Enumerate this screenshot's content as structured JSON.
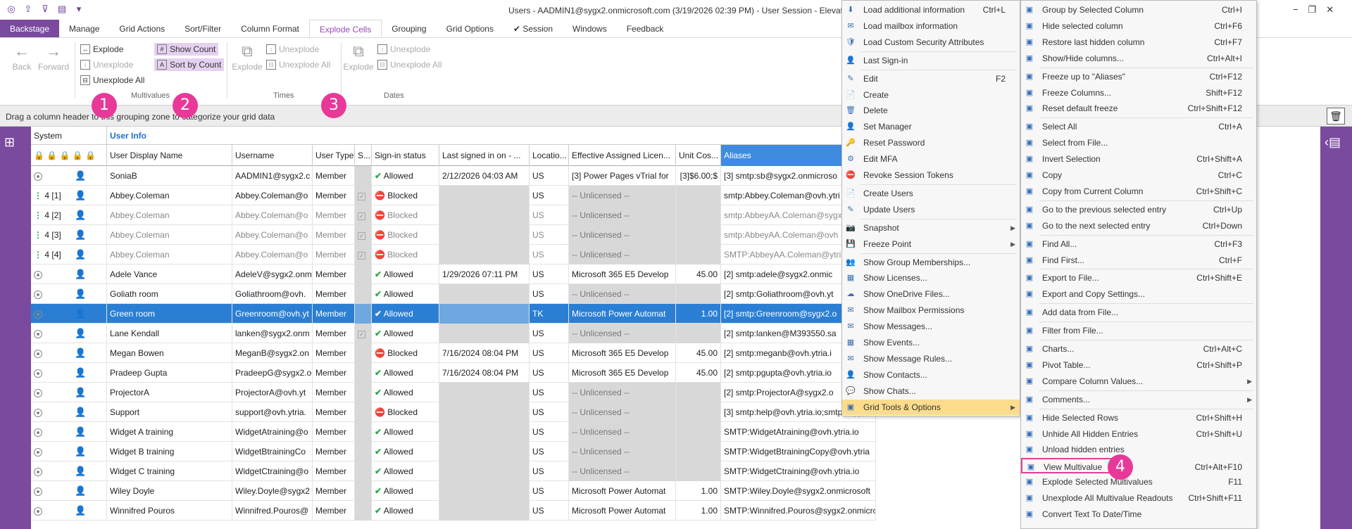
{
  "window": {
    "title": "Users - AADMIN1@sygx2.onmicrosoft.com (3/19/2026 02:39 PM) - User Session - Elevated",
    "controls": [
      "−",
      "❐",
      "✕"
    ]
  },
  "ribbon": {
    "tabs": [
      "Backstage",
      "Manage",
      "Grid Actions",
      "Sort/Filter",
      "Column Format",
      "Explode Cells",
      "Grouping",
      "Grid Options",
      "✔ Session",
      "Windows",
      "Feedback"
    ],
    "back_label": "Back",
    "forward_label": "Forward",
    "explode": "Explode",
    "unexplode": "Unexplode",
    "unexplode_all": "Unexplode All",
    "show_count": "Show Count",
    "sort_by_count": "Sort by Count",
    "multivalues_group": "Multivalues",
    "times_explode": "Explode",
    "times_unexplode": "Unexplode",
    "times_unexplode_all": "Unexplode All",
    "times_group": "Times",
    "dates_explode": "Explode",
    "dates_unexplode": "Unexplode",
    "dates_unexplode_all": "Unexplode All",
    "dates_group": "Dates"
  },
  "group_zone": {
    "text": "Drag a column header to this grouping zone to categorize your grid data"
  },
  "grid": {
    "bands": {
      "system": "System",
      "user_info": "User Info"
    },
    "columns": [
      "User Display Name",
      "Username",
      "User Type",
      "S...",
      "Sign-in status",
      "Last signed in on - ...",
      "Locatio...",
      "Effective Assigned Licen...",
      "Unit Cos...",
      "Aliases"
    ],
    "rows": [
      {
        "n": "",
        "idx": "",
        "name": "SoniaB",
        "user": "AADMIN1@sygx2.c",
        "type": "Member",
        "s": "",
        "status": "Allowed",
        "last": "2/12/2026 04:03 AM",
        "loc": "US",
        "lic": "[3] Power Pages vTrial for",
        "cost": "[3]$6.00;$",
        "alias": "[3] smtp:sb@sygx2.onmicroso",
        "kind": "normal"
      },
      {
        "n": "4",
        "idx": "[1]",
        "name": "Abbey.Coleman",
        "user": "Abbey.Coleman@o",
        "type": "Member",
        "s": "chk",
        "status": "Blocked",
        "last": "",
        "loc": "US",
        "lic": "-- Unlicensed --",
        "cost": "",
        "alias": "smtp:Abbey.Coleman@ovh.ytri",
        "kind": "multi"
      },
      {
        "n": "4",
        "idx": "[2]",
        "name": "Abbey.Coleman",
        "user": "Abbey.Coleman@o",
        "type": "Member",
        "s": "chk",
        "status": "Blocked",
        "last": "",
        "loc": "US",
        "lic": "-- Unlicensed --",
        "cost": "",
        "alias": "smtp:AbbeyAA.Coleman@sygx",
        "kind": "dim"
      },
      {
        "n": "4",
        "idx": "[3]",
        "name": "Abbey.Coleman",
        "user": "Abbey.Coleman@o",
        "type": "Member",
        "s": "chk",
        "status": "Blocked",
        "last": "",
        "loc": "US",
        "lic": "-- Unlicensed --",
        "cost": "",
        "alias": "smtp:AbbeyAA.Coleman@ovh",
        "kind": "dim"
      },
      {
        "n": "4",
        "idx": "[4]",
        "name": "Abbey.Coleman",
        "user": "Abbey.Coleman@o",
        "type": "Member",
        "s": "chk",
        "status": "Blocked",
        "last": "",
        "loc": "US",
        "lic": "-- Unlicensed --",
        "cost": "",
        "alias": "SMTP:AbbeyAA.Coleman@ytri",
        "kind": "dim"
      },
      {
        "n": "",
        "idx": "",
        "name": "Adele Vance",
        "user": "AdeleV@sygx2.onm",
        "type": "Member",
        "s": "",
        "status": "Allowed",
        "last": "1/29/2026 07:11 PM",
        "loc": "US",
        "lic": "Microsoft 365 E5 Develop",
        "cost": "45.00",
        "alias": "[2] smtp:adele@sygx2.onmic",
        "kind": "normal"
      },
      {
        "n": "",
        "idx": "",
        "name": "Goliath room",
        "user": "Goliathroom@ovh.",
        "type": "Member",
        "s": "",
        "status": "Allowed",
        "last": "",
        "loc": "US",
        "lic": "-- Unlicensed --",
        "cost": "",
        "alias": "[2] smtp:Goliathroom@ovh.yt",
        "kind": "normal"
      },
      {
        "n": "",
        "idx": "",
        "name": "Green room",
        "user": "Greenroom@ovh.yt",
        "type": "Member",
        "s": "",
        "status": "Allowed",
        "last": "",
        "loc": "TK",
        "lic": "Microsoft Power Automat",
        "cost": "1.00",
        "alias": "[2] smtp:Greenroom@sygx2.o",
        "kind": "sel"
      },
      {
        "n": "",
        "idx": "",
        "name": "Lane Kendall",
        "user": "lanken@sygx2.onm",
        "type": "Member",
        "s": "chk",
        "status": "Allowed",
        "last": "",
        "loc": "US",
        "lic": "-- Unlicensed --",
        "cost": "",
        "alias": "[2] smtp:lanken@M393550.sa",
        "kind": "normal"
      },
      {
        "n": "",
        "idx": "",
        "name": "Megan Bowen",
        "user": "MeganB@sygx2.on",
        "type": "Member",
        "s": "",
        "status": "Blocked",
        "last": "7/16/2024 08:04 PM",
        "loc": "US",
        "lic": "Microsoft 365 E5 Develop",
        "cost": "45.00",
        "alias": "[2] smtp:meganb@ovh.ytria.i",
        "kind": "normal"
      },
      {
        "n": "",
        "idx": "",
        "name": "Pradeep Gupta",
        "user": "PradeepG@sygx2.o",
        "type": "Member",
        "s": "",
        "status": "Allowed",
        "last": "7/16/2024 08:04 PM",
        "loc": "US",
        "lic": "Microsoft 365 E5 Develop",
        "cost": "45.00",
        "alias": "[2] smtp:pgupta@ovh.ytria.io",
        "kind": "normal"
      },
      {
        "n": "",
        "idx": "",
        "name": "ProjectorA",
        "user": "ProjectorA@ovh.yt",
        "type": "Member",
        "s": "",
        "status": "Allowed",
        "last": "",
        "loc": "US",
        "lic": "-- Unlicensed --",
        "cost": "",
        "alias": "[2] smtp:ProjectorA@sygx2.o",
        "kind": "normal"
      },
      {
        "n": "",
        "idx": "",
        "name": "Support",
        "user": "support@ovh.ytria.",
        "type": "Member",
        "s": "",
        "status": "Blocked",
        "last": "",
        "loc": "US",
        "lic": "-- Unlicensed --",
        "cost": "",
        "alias": "[3] smtp:help@ovh.ytria.io;smtp:supp",
        "kind": "normal"
      },
      {
        "n": "",
        "idx": "",
        "name": "Widget A training",
        "user": "WidgetAtraining@o",
        "type": "Member",
        "s": "",
        "status": "Allowed",
        "last": "",
        "loc": "US",
        "lic": "-- Unlicensed --",
        "cost": "",
        "alias": "SMTP:WidgetAtraining@ovh.ytria.io",
        "kind": "normal"
      },
      {
        "n": "",
        "idx": "",
        "name": "Widget B training",
        "user": "WidgetBtrainingCo",
        "type": "Member",
        "s": "",
        "status": "Allowed",
        "last": "",
        "loc": "US",
        "lic": "-- Unlicensed --",
        "cost": "",
        "alias": "SMTP:WidgetBtrainingCopy@ovh.ytria",
        "kind": "normal"
      },
      {
        "n": "",
        "idx": "",
        "name": "Widget C training",
        "user": "WidgetCtraining@o",
        "type": "Member",
        "s": "",
        "status": "Allowed",
        "last": "",
        "loc": "US",
        "lic": "-- Unlicensed --",
        "cost": "",
        "alias": "SMTP:WidgetCtraining@ovh.ytria.io",
        "kind": "normal"
      },
      {
        "n": "",
        "idx": "",
        "name": "Wiley Doyle",
        "user": "Wiley.Doyle@sygx2",
        "type": "Member",
        "s": "",
        "status": "Allowed",
        "last": "",
        "loc": "US",
        "lic": "Microsoft Power Automat",
        "cost": "1.00",
        "alias": "SMTP:Wiley.Doyle@sygx2.onmicrosoft",
        "kind": "normal"
      },
      {
        "n": "",
        "idx": "",
        "name": "Winnifred Pouros",
        "user": "Winnifred.Pouros@",
        "type": "Member",
        "s": "",
        "status": "Allowed",
        "last": "",
        "loc": "US",
        "lic": "Microsoft Power Automat",
        "cost": "1.00",
        "alias": "SMTP:Winnifred.Pouros@sygx2.onmicro",
        "kind": "normal"
      }
    ]
  },
  "context_menu": {
    "items": [
      {
        "label": "Load additional information",
        "shortcut": "Ctrl+L",
        "icon": "⬇"
      },
      {
        "label": "Load mailbox information",
        "shortcut": "",
        "icon": "✉"
      },
      {
        "label": "Load Custom Security Attributes",
        "shortcut": "",
        "icon": "🛡"
      },
      {
        "sep": true
      },
      {
        "label": "Last Sign-in",
        "shortcut": "",
        "icon": "👤"
      },
      {
        "sep": true
      },
      {
        "label": "Edit",
        "shortcut": "F2",
        "icon": "✎"
      },
      {
        "label": "Create",
        "shortcut": "",
        "icon": "📄"
      },
      {
        "label": "Delete",
        "shortcut": "",
        "icon": "🗑"
      },
      {
        "label": "Set Manager",
        "shortcut": "",
        "icon": "👤"
      },
      {
        "label": "Reset Password",
        "shortcut": "",
        "icon": "🔑"
      },
      {
        "label": "Edit MFA",
        "shortcut": "",
        "icon": "⚙"
      },
      {
        "label": "Revoke Session Tokens",
        "shortcut": "",
        "icon": "⛔"
      },
      {
        "sep": true
      },
      {
        "label": "Create Users",
        "shortcut": "",
        "icon": "📄"
      },
      {
        "label": "Update Users",
        "shortcut": "",
        "icon": "✎"
      },
      {
        "sep": true
      },
      {
        "label": "Snapshot",
        "shortcut": "",
        "icon": "📷",
        "sub": true
      },
      {
        "label": "Freeze Point",
        "shortcut": "",
        "icon": "💾",
        "sub": true
      },
      {
        "sep": true
      },
      {
        "label": "Show Group Memberships...",
        "shortcut": "",
        "icon": "👥"
      },
      {
        "label": "Show Licenses...",
        "shortcut": "",
        "icon": "▦"
      },
      {
        "label": "Show OneDrive Files...",
        "shortcut": "",
        "icon": "☁"
      },
      {
        "label": "Show Mailbox Permissions",
        "shortcut": "",
        "icon": "✉"
      },
      {
        "label": "Show Messages...",
        "shortcut": "",
        "icon": "✉"
      },
      {
        "label": "Show Events...",
        "shortcut": "",
        "icon": "▦"
      },
      {
        "label": "Show Message Rules...",
        "shortcut": "",
        "icon": "✉"
      },
      {
        "label": "Show Contacts...",
        "shortcut": "",
        "icon": "👤"
      },
      {
        "label": "Show Chats...",
        "shortcut": "",
        "icon": "💬"
      },
      {
        "label": "Grid Tools & Options",
        "shortcut": "",
        "icon": "",
        "sub": true,
        "hot": true
      }
    ]
  },
  "submenu": {
    "items": [
      {
        "label": "Group by Selected Column",
        "shortcut": "Ctrl+I"
      },
      {
        "label": "Hide selected column",
        "shortcut": "Ctrl+F6"
      },
      {
        "label": "Restore last hidden column",
        "shortcut": "Ctrl+F7"
      },
      {
        "label": "Show/Hide columns...",
        "shortcut": "Ctrl+Alt+I"
      },
      {
        "sep": true
      },
      {
        "label": "Freeze up to \"Aliases\"",
        "shortcut": "Ctrl+F12"
      },
      {
        "label": "Freeze Columns...",
        "shortcut": "Shift+F12"
      },
      {
        "label": "Reset default freeze",
        "shortcut": "Ctrl+Shift+F12"
      },
      {
        "sep": true
      },
      {
        "label": "Select All",
        "shortcut": "Ctrl+A"
      },
      {
        "label": "Select from File...",
        "shortcut": ""
      },
      {
        "label": "Invert Selection",
        "shortcut": "Ctrl+Shift+A"
      },
      {
        "label": "Copy",
        "shortcut": "Ctrl+C"
      },
      {
        "label": "Copy from Current Column",
        "shortcut": "Ctrl+Shift+C"
      },
      {
        "sep": true
      },
      {
        "label": "Go to the previous selected entry",
        "shortcut": "Ctrl+Up"
      },
      {
        "label": "Go to the next selected entry",
        "shortcut": "Ctrl+Down"
      },
      {
        "sep": true
      },
      {
        "label": "Find All...",
        "shortcut": "Ctrl+F3"
      },
      {
        "label": "Find First...",
        "shortcut": "Ctrl+F"
      },
      {
        "sep": true
      },
      {
        "label": "Export to File...",
        "shortcut": "Ctrl+Shift+E"
      },
      {
        "label": "Export and Copy Settings...",
        "shortcut": ""
      },
      {
        "sep": true
      },
      {
        "label": "Add data from File...",
        "shortcut": ""
      },
      {
        "sep": true
      },
      {
        "label": "Filter from File...",
        "shortcut": ""
      },
      {
        "sep": true
      },
      {
        "label": "Charts...",
        "shortcut": "Ctrl+Alt+C"
      },
      {
        "label": "Pivot Table...",
        "shortcut": "Ctrl+Shift+P"
      },
      {
        "label": "Compare Column Values...",
        "shortcut": "",
        "sub": true
      },
      {
        "sep": true
      },
      {
        "label": "Comments...",
        "shortcut": "",
        "sub": true
      },
      {
        "sep": true
      },
      {
        "label": "Hide Selected Rows",
        "shortcut": "Ctrl+Shift+H"
      },
      {
        "label": "Unhide All Hidden Entries",
        "shortcut": "Ctrl+Shift+U"
      },
      {
        "label": "Unload hidden entries",
        "shortcut": ""
      },
      {
        "label": "View Multivalue",
        "shortcut": "Ctrl+Alt+F10",
        "boxed": true
      },
      {
        "label": "Explode Selected Multivalues",
        "shortcut": "F11"
      },
      {
        "label": "Unexplode All Multivalue Readouts",
        "shortcut": "Ctrl+Shift+F11"
      },
      {
        "label": "Convert Text To Date/Time",
        "shortcut": ""
      }
    ]
  },
  "annotations": [
    "1",
    "2",
    "3",
    "4"
  ]
}
